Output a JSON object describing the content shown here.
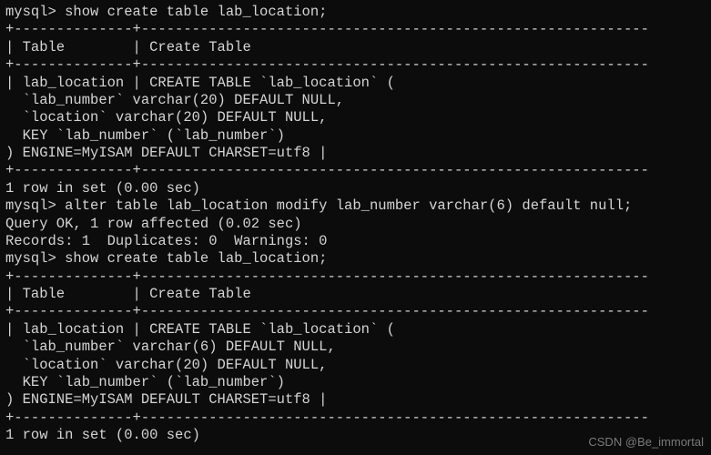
{
  "lines": [
    "mysql> show create table lab_location;",
    "+--------------+------------------------------------------------------------",
    "| Table        | Create Table",
    "+--------------+------------------------------------------------------------",
    "| lab_location | CREATE TABLE `lab_location` (",
    "  `lab_number` varchar(20) DEFAULT NULL,",
    "  `location` varchar(20) DEFAULT NULL,",
    "  KEY `lab_number` (`lab_number`)",
    ") ENGINE=MyISAM DEFAULT CHARSET=utf8 |",
    "+--------------+------------------------------------------------------------",
    "1 row in set (0.00 sec)",
    "",
    "mysql> alter table lab_location modify lab_number varchar(6) default null;",
    "Query OK, 1 row affected (0.02 sec)",
    "Records: 1  Duplicates: 0  Warnings: 0",
    "",
    "mysql> show create table lab_location;",
    "+--------------+------------------------------------------------------------",
    "| Table        | Create Table",
    "+--------------+------------------------------------------------------------",
    "| lab_location | CREATE TABLE `lab_location` (",
    "  `lab_number` varchar(6) DEFAULT NULL,",
    "  `location` varchar(20) DEFAULT NULL,",
    "  KEY `lab_number` (`lab_number`)",
    ") ENGINE=MyISAM DEFAULT CHARSET=utf8 |",
    "+--------------+------------------------------------------------------------",
    "1 row in set (0.00 sec)"
  ],
  "watermark": "CSDN @Be_immortal"
}
